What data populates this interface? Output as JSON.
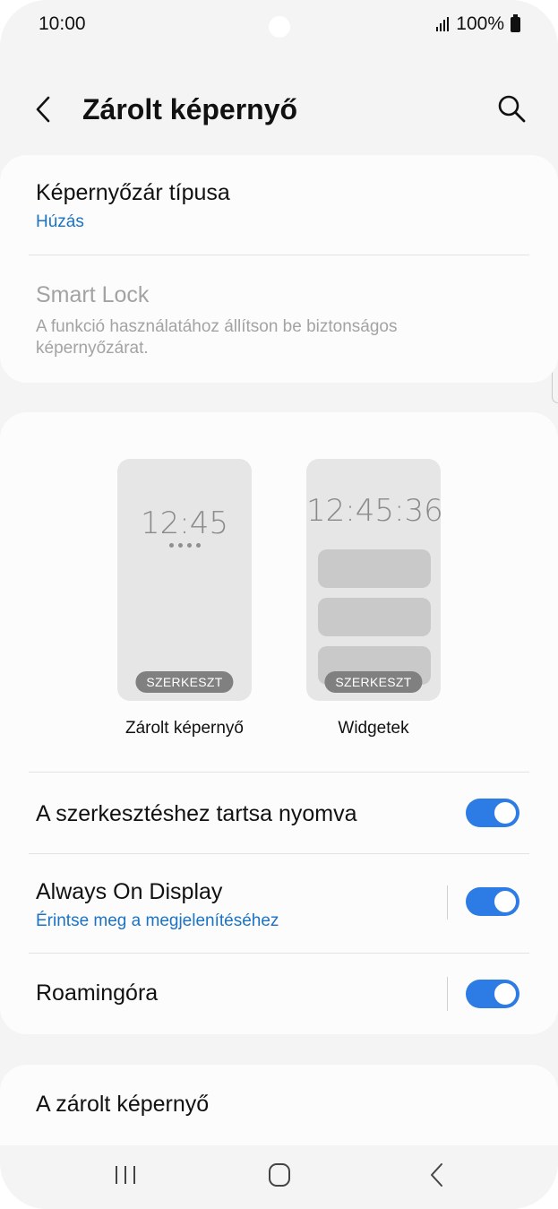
{
  "status": {
    "time": "10:00",
    "battery": "100%"
  },
  "header": {
    "title": "Zárolt képernyő"
  },
  "lock_type": {
    "title": "Képernyőzár típusa",
    "value": "Húzás"
  },
  "smart_lock": {
    "title": "Smart Lock",
    "subtitle": "A funkció használatához állítson be biztonságos képernyőzárat."
  },
  "previews": {
    "lock": {
      "clock": "12:45",
      "edit_label": "SZERKESZT",
      "caption": "Zárolt képernyő"
    },
    "widgets": {
      "clock": "12:45:36",
      "edit_label": "SZERKESZT",
      "caption": "Widgetek"
    }
  },
  "settings": [
    {
      "title": "A szerkesztéshez tartsa nyomva",
      "enabled": true
    },
    {
      "title": "Always On Display",
      "subtitle": "Érintse meg a megjelenítéséhez",
      "enabled": true
    },
    {
      "title": "Roamingóra",
      "enabled": true
    }
  ],
  "about": {
    "title": "A zárolt képernyő"
  },
  "colors": {
    "accent": "#2d7be5",
    "link": "#1a73c4",
    "background": "#f4f4f4",
    "card": "#fcfcfc"
  },
  "icons": [
    "back-icon",
    "search-icon",
    "recents-icon",
    "home-icon",
    "nav-back-icon"
  ]
}
